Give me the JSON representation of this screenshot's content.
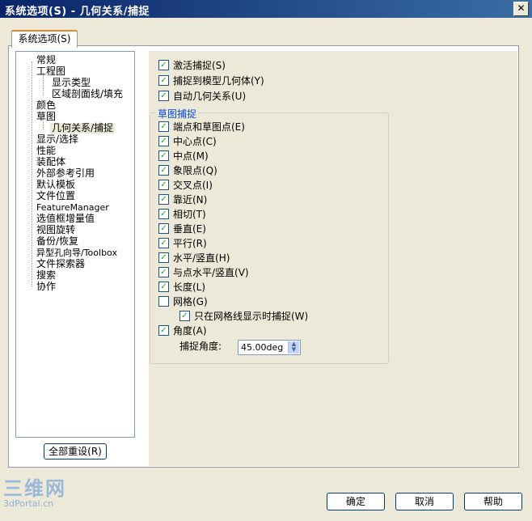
{
  "window": {
    "title": "系统选项(S) - 几何关系/捕捉",
    "close_glyph": "✕"
  },
  "tab": {
    "label": "系统选项(S)"
  },
  "tree": {
    "items": [
      {
        "label": "常规"
      },
      {
        "label": "工程图"
      },
      {
        "label": "显示类型"
      },
      {
        "label": "区域剖面线/填充"
      },
      {
        "label": "颜色"
      },
      {
        "label": "草图"
      },
      {
        "label": "几何关系/捕捉"
      },
      {
        "label": "显示/选择"
      },
      {
        "label": "性能"
      },
      {
        "label": "装配体"
      },
      {
        "label": "外部参考引用"
      },
      {
        "label": "默认模板"
      },
      {
        "label": "文件位置"
      },
      {
        "label": "FeatureManager"
      },
      {
        "label": "选值框增量值"
      },
      {
        "label": "视图旋转"
      },
      {
        "label": "备份/恢复"
      },
      {
        "label": "异型孔向导/Toolbox"
      },
      {
        "label": "文件探索器"
      },
      {
        "label": "搜索"
      },
      {
        "label": "协作"
      }
    ],
    "selected": "几何关系/捕捉"
  },
  "reset_button": "全部重设(R)",
  "options": {
    "enable_snap": {
      "label": "激活捕捉(S)",
      "checked": true
    },
    "snap_to_model": {
      "label": "捕捉到模型几何体(Y)",
      "checked": true
    },
    "auto_relations": {
      "label": "自动几何关系(U)",
      "checked": true
    }
  },
  "sketch_snaps": {
    "group_label": "草图捕捉",
    "items": [
      {
        "label": "端点和草图点(E)",
        "checked": true
      },
      {
        "label": "中心点(C)",
        "checked": true
      },
      {
        "label": "中点(M)",
        "checked": true
      },
      {
        "label": "象限点(Q)",
        "checked": true
      },
      {
        "label": "交叉点(I)",
        "checked": true
      },
      {
        "label": "靠近(N)",
        "checked": true
      },
      {
        "label": "相切(T)",
        "checked": true
      },
      {
        "label": "垂直(E)",
        "checked": true
      },
      {
        "label": "平行(R)",
        "checked": true
      },
      {
        "label": "水平/竖直(H)",
        "checked": true
      },
      {
        "label": "与点水平/竖直(V)",
        "checked": true
      },
      {
        "label": "长度(L)",
        "checked": true
      },
      {
        "label": "网格(G)",
        "checked": false
      },
      {
        "label": "只在网格线显示时捕捉(W)",
        "checked": true
      },
      {
        "label": "角度(A)",
        "checked": true
      }
    ],
    "angle_label": "捕捉角度:",
    "angle_value": "45.00deg"
  },
  "buttons": {
    "ok": "确定",
    "cancel": "取消",
    "help": "帮助"
  },
  "watermark": {
    "big": "三维网",
    "small": "3dPortal.cn"
  },
  "colors": {
    "title_bar": "#0a246a",
    "group_label": "#0046d5",
    "check": "#21a121",
    "tab_accent": "#e68b2c"
  }
}
